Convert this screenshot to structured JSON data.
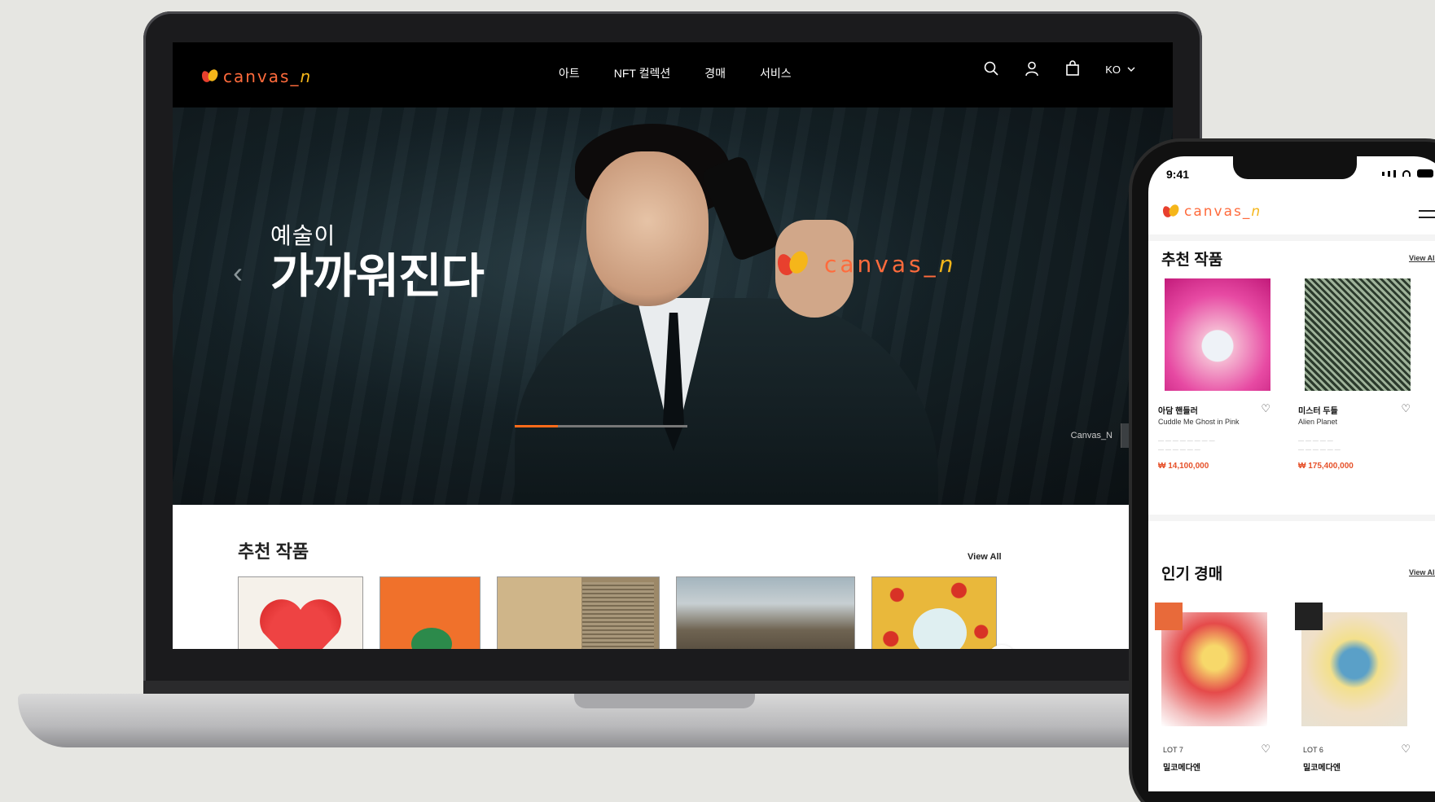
{
  "desktop": {
    "logo_text": "canvas_",
    "logo_text_n": "n",
    "menu": [
      "아트",
      "NFT 컬렉션",
      "경매",
      "서비스"
    ],
    "lang": "KO",
    "hero": {
      "line1": "예술이",
      "line2": "가까워진다",
      "brand": "canvas_",
      "brand_n": "n",
      "progress_fraction": 0.25,
      "control_label": "Canvas_N"
    },
    "recommended": {
      "title": "추천 작품",
      "view_all": "View All"
    }
  },
  "mobile": {
    "time": "9:41",
    "logo_text": "canvas_",
    "logo_text_n": "n",
    "recommended": {
      "title": "추천 작품",
      "view_all": "View All",
      "items": [
        {
          "artist": "아담 핸들러",
          "title": "Cuddle Me Ghost in Pink",
          "price": "₩ 14,100,000"
        },
        {
          "artist": "미스터 두들",
          "title": "Alien Planet",
          "price": "₩ 175,400,000"
        }
      ]
    },
    "auction": {
      "title": "인기 경매",
      "view_all": "View All",
      "items": [
        {
          "lot": "LOT 7",
          "artist": "밀코메다엔",
          "badge": ""
        },
        {
          "lot": "LOT 6",
          "artist": "밀코메다엔",
          "badge": ""
        }
      ]
    }
  },
  "colors": {
    "accent": "#ff6b1a",
    "brand_orange": "#ff6b3c",
    "brand_yellow": "#f5b61a",
    "price_red": "#e6512a"
  },
  "icons": [
    "search-icon",
    "user-icon",
    "cart-icon",
    "chevron-down-icon",
    "chevron-left-icon",
    "play-icon",
    "speaker-icon",
    "arrow-right-icon",
    "heart-icon",
    "menu-icon"
  ]
}
